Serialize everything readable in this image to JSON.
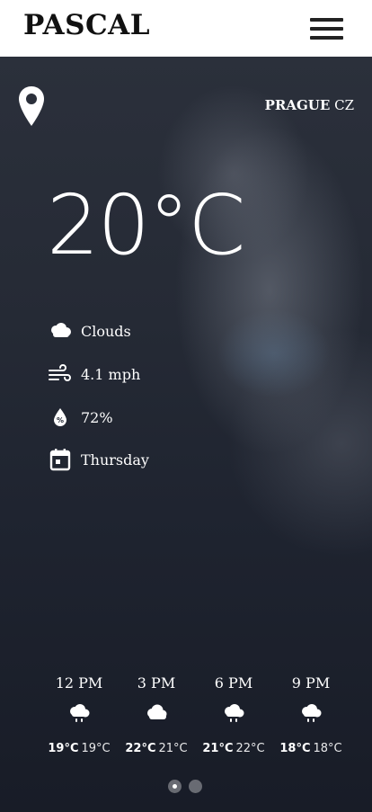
{
  "header": {
    "brand": "PASCAL"
  },
  "location": {
    "city": "PRAGUE",
    "country": "CZ"
  },
  "current": {
    "temperature": "20°C",
    "condition": "Clouds",
    "wind": "4.1 mph",
    "humidity": "72%",
    "day": "Thursday"
  },
  "forecast": [
    {
      "time": "12 PM",
      "high": "19°C",
      "low": "19°C",
      "icon": "rain-cloud-icon"
    },
    {
      "time": "3 PM",
      "high": "22°C",
      "low": "21°C",
      "icon": "cloud-icon"
    },
    {
      "time": "6 PM",
      "high": "21°C",
      "low": "22°C",
      "icon": "rain-cloud-icon"
    },
    {
      "time": "9 PM",
      "high": "18°C",
      "low": "18°C",
      "icon": "rain-cloud-icon"
    }
  ],
  "pager": {
    "pages": 2,
    "current": 1
  },
  "colors": {
    "header_bg": "#ffffff",
    "brand_text": "#111111",
    "hero_bg": "#1f2430",
    "text": "#ffffff"
  }
}
